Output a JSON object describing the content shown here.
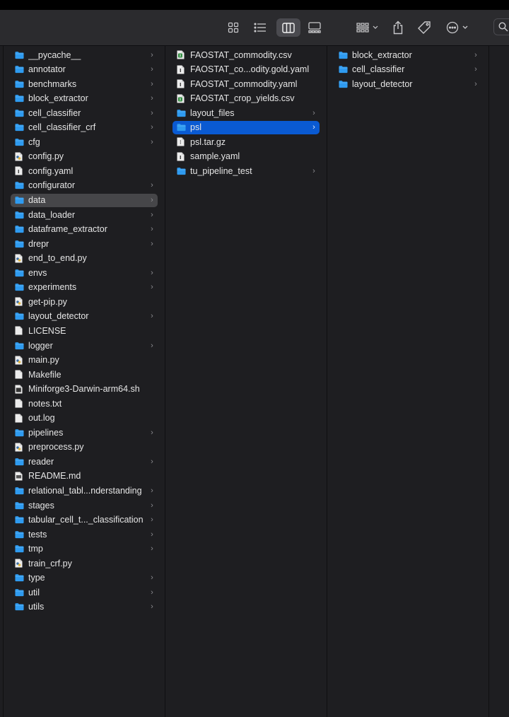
{
  "toolbar": {
    "buttons": [
      {
        "name": "icon-view-button",
        "icon": "grid-icon"
      },
      {
        "name": "list-view-button",
        "icon": "list-icon"
      },
      {
        "name": "column-view-button",
        "icon": "columns-icon",
        "selected": true
      },
      {
        "name": "gallery-view-button",
        "icon": "gallery-icon"
      },
      {
        "name": "group-button",
        "icon": "group-icon"
      },
      {
        "name": "share-button",
        "icon": "share-icon"
      },
      {
        "name": "tag-button",
        "icon": "tag-icon"
      },
      {
        "name": "more-button",
        "icon": "ellipsis-icon"
      },
      {
        "name": "search-button",
        "icon": "search-icon"
      }
    ]
  },
  "colors": {
    "folder": "#2f9bf0",
    "selection_blue": "#0a5ad2",
    "selection_gray": "#464649",
    "text": "#e6e6e6",
    "chevron": "#8b8b8f"
  },
  "columns": [
    {
      "items": [
        {
          "name": "__pycache__",
          "type": "folder"
        },
        {
          "name": "annotator",
          "type": "folder"
        },
        {
          "name": "benchmarks",
          "type": "folder"
        },
        {
          "name": "block_extractor",
          "type": "folder"
        },
        {
          "name": "cell_classifier",
          "type": "folder"
        },
        {
          "name": "cell_classifier_crf",
          "type": "folder"
        },
        {
          "name": "cfg",
          "type": "folder"
        },
        {
          "name": "config.py",
          "type": "python"
        },
        {
          "name": "config.yaml",
          "type": "yaml"
        },
        {
          "name": "configurator",
          "type": "folder"
        },
        {
          "name": "data",
          "type": "folder",
          "selected": "gray"
        },
        {
          "name": "data_loader",
          "type": "folder"
        },
        {
          "name": "dataframe_extractor",
          "type": "folder"
        },
        {
          "name": "drepr",
          "type": "folder"
        },
        {
          "name": "end_to_end.py",
          "type": "python"
        },
        {
          "name": "envs",
          "type": "folder"
        },
        {
          "name": "experiments",
          "type": "folder"
        },
        {
          "name": "get-pip.py",
          "type": "python"
        },
        {
          "name": "layout_detector",
          "type": "folder"
        },
        {
          "name": "LICENSE",
          "type": "doc"
        },
        {
          "name": "logger",
          "type": "folder"
        },
        {
          "name": "main.py",
          "type": "python"
        },
        {
          "name": "Makefile",
          "type": "doc"
        },
        {
          "name": "Miniforge3-Darwin-arm64.sh",
          "type": "shell"
        },
        {
          "name": "notes.txt",
          "type": "doc"
        },
        {
          "name": "out.log",
          "type": "doc"
        },
        {
          "name": "pipelines",
          "type": "folder"
        },
        {
          "name": "preprocess.py",
          "type": "python"
        },
        {
          "name": "reader",
          "type": "folder"
        },
        {
          "name": "README.md",
          "type": "markdown"
        },
        {
          "name": "relational_tabl...nderstanding",
          "type": "folder"
        },
        {
          "name": "stages",
          "type": "folder"
        },
        {
          "name": "tabular_cell_t..._classification",
          "type": "folder"
        },
        {
          "name": "tests",
          "type": "folder"
        },
        {
          "name": "tmp",
          "type": "folder"
        },
        {
          "name": "train_crf.py",
          "type": "python"
        },
        {
          "name": "type",
          "type": "folder"
        },
        {
          "name": "util",
          "type": "folder"
        },
        {
          "name": "utils",
          "type": "folder"
        }
      ]
    },
    {
      "items": [
        {
          "name": "FAOSTAT_commodity.csv",
          "type": "csv"
        },
        {
          "name": "FAOSTAT_co...odity.gold.yaml",
          "type": "yaml"
        },
        {
          "name": "FAOSTAT_commodity.yaml",
          "type": "yaml"
        },
        {
          "name": "FAOSTAT_crop_yields.csv",
          "type": "csv"
        },
        {
          "name": "layout_files",
          "type": "folder"
        },
        {
          "name": "psl",
          "type": "folder",
          "selected": "blue"
        },
        {
          "name": "psl.tar.gz",
          "type": "archive"
        },
        {
          "name": "sample.yaml",
          "type": "yaml"
        },
        {
          "name": "tu_pipeline_test",
          "type": "folder"
        }
      ]
    },
    {
      "items": [
        {
          "name": "block_extractor",
          "type": "folder"
        },
        {
          "name": "cell_classifier",
          "type": "folder"
        },
        {
          "name": "layout_detector",
          "type": "folder"
        }
      ]
    },
    {
      "items": []
    }
  ]
}
